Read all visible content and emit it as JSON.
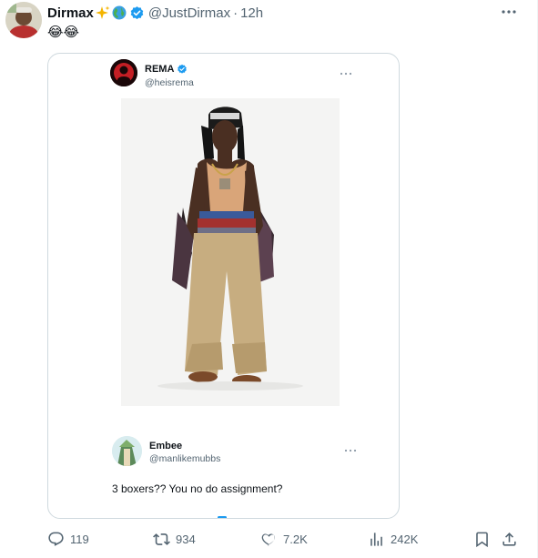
{
  "tweet": {
    "author_name": "Dirmax",
    "handle": "@JustDirmax",
    "separator": "·",
    "time": "12h",
    "text": "😂😂"
  },
  "quote": {
    "author_name": "REMA",
    "handle": "@heisrema"
  },
  "reply": {
    "author_name": "Embee",
    "handle": "@manlikemubbs",
    "text": "3 boxers?? You no do assignment?"
  },
  "actions": {
    "replies": "119",
    "retweets": "934",
    "likes": "7.2K",
    "views": "242K"
  },
  "colors": {
    "accent": "#1d9bf0",
    "muted": "#536471",
    "text": "#0f1419",
    "border": "#cfd9de"
  },
  "icons": [
    "sparkles-icon",
    "globe-icon",
    "verified-badge-icon",
    "more-icon",
    "reply-icon",
    "retweet-icon",
    "like-icon",
    "views-icon",
    "bookmark-icon",
    "share-icon"
  ]
}
